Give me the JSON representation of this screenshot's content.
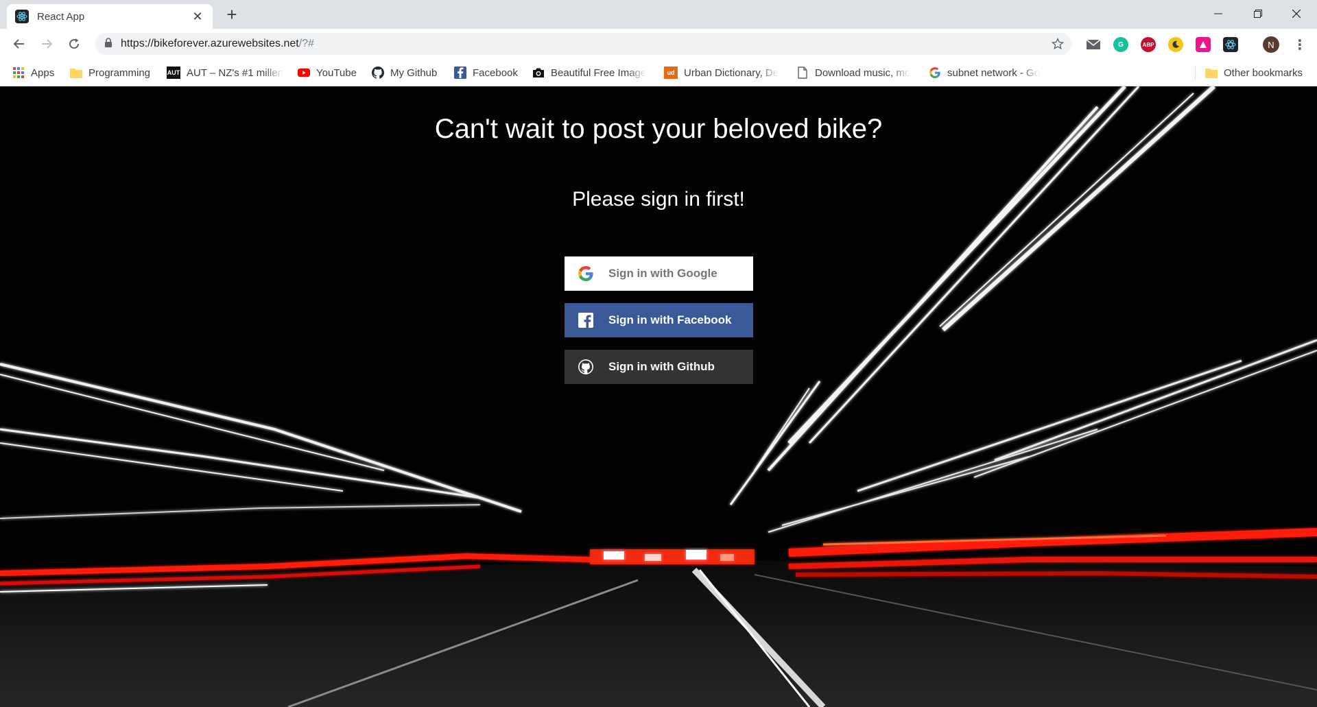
{
  "browser": {
    "tab_title": "React App",
    "url_host": "https://bikeforever.azurewebsites.net",
    "url_path": "/?#",
    "profile_initial": "N",
    "bookmarks": [
      {
        "label": "Apps",
        "icon": "apps-grid-icon"
      },
      {
        "label": "Programming",
        "icon": "folder-icon"
      },
      {
        "label": "AUT – NZ's #1 millen",
        "icon": "aut-logo-icon",
        "icon_text": "AUT"
      },
      {
        "label": "YouTube",
        "icon": "youtube-icon"
      },
      {
        "label": "My Github",
        "icon": "github-icon"
      },
      {
        "label": "Facebook",
        "icon": "facebook-icon"
      },
      {
        "label": "Beautiful Free Image",
        "icon": "camera-icon"
      },
      {
        "label": "Urban Dictionary, De",
        "icon": "urban-dictionary-icon",
        "icon_text": "ud"
      },
      {
        "label": "Download music, mo",
        "icon": "page-icon"
      },
      {
        "label": "subnet network - Go",
        "icon": "google-icon"
      }
    ],
    "other_bookmarks": "Other bookmarks",
    "extension_labels": {
      "abp": "ABP"
    }
  },
  "page": {
    "headline": "Can't wait to post your beloved bike?",
    "subline": "Please sign in first!",
    "buttons": {
      "google": "Sign in with Google",
      "facebook": "Sign in with Facebook",
      "github": "Sign in with Github"
    }
  },
  "colors": {
    "facebook": "#3b5998",
    "github": "#333333",
    "google_text": "#757575",
    "light_trail_red": "#ff1a0a"
  }
}
